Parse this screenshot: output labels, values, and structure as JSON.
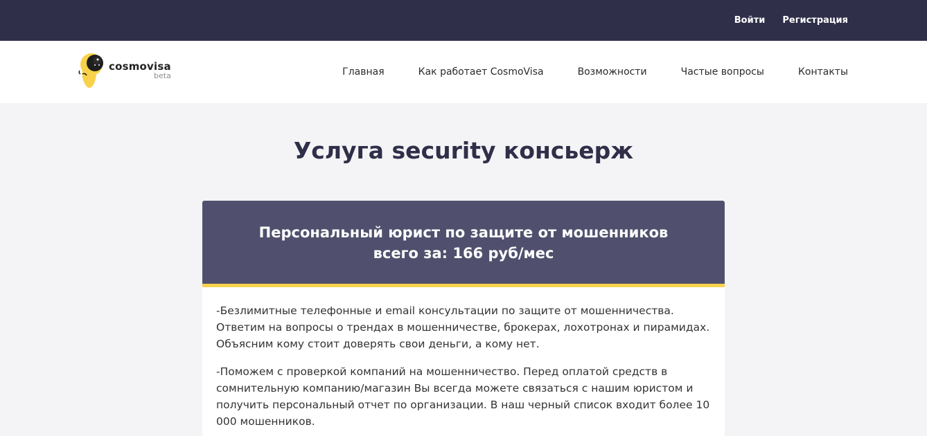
{
  "topbar": {
    "login": "Войти",
    "register": "Регистрация"
  },
  "logo": {
    "brand": "cosmovisa",
    "sub": "beta",
    "accent_color": "#f8d24b"
  },
  "nav": {
    "items": [
      {
        "label": "Главная"
      },
      {
        "label": "Как работает CosmoVisa"
      },
      {
        "label": "Возможности"
      },
      {
        "label": "Частые вопросы"
      },
      {
        "label": "Контакты"
      }
    ]
  },
  "main": {
    "title": "Услуга security консьерж",
    "card": {
      "heading_line1": "Персональный юрист по защите от мошенников",
      "heading_line2": "всего за: 166 руб/мес",
      "paragraphs": [
        "-Безлимитные телефонные и email консультации по защите от мошенничества. Ответим на вопросы о трендах в мошенничестве, брокерах, лохотронах и пирамидах. Объясним кому стоит доверять свои деньги, а кому нет.",
        "-Поможем с проверкой компаний на мошенничество. Перед оплатой средств в сомнительную компанию/магазин Вы всегда можете связаться с нашим юристом и получить персональный отчет по организации. В наш черный список входит более 10 000 мошенников."
      ]
    }
  },
  "colors": {
    "topbar_bg": "#2f2f4a",
    "card_header_bg": "#50506e",
    "accent": "#f8d24b"
  }
}
